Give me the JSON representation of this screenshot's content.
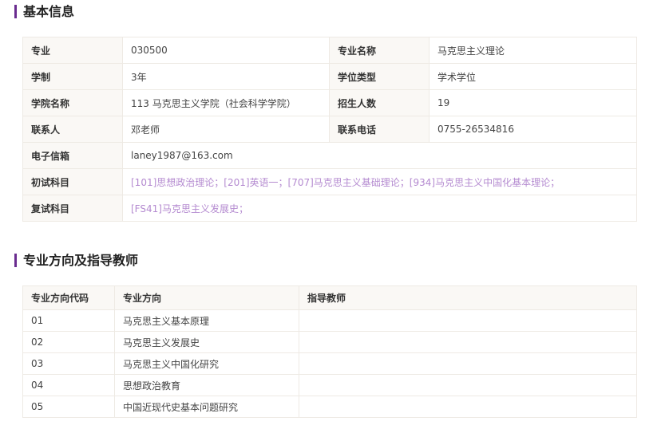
{
  "colors": {
    "accent": "#6a2c8f",
    "link": "#b48ad0",
    "label_bg": "#faf8f5",
    "border": "#eeeae4"
  },
  "basic": {
    "title": "基本信息",
    "major_label": "专业",
    "major_value": "030500",
    "major_name_label": "专业名称",
    "major_name_value": "马克思主义理论",
    "duration_label": "学制",
    "duration_value": "3年",
    "degree_label": "学位类型",
    "degree_value": "学术学位",
    "college_label": "学院名称",
    "college_value": "113 马克思主义学院（社会科学学院）",
    "enroll_label": "招生人数",
    "enroll_value": "19",
    "contact_label": "联系人",
    "contact_value": "邓老师",
    "phone_label": "联系电话",
    "phone_value": "0755-26534816",
    "email_label": "电子信箱",
    "email_value": "laney1987@163.com",
    "prelim_label": "初试科目",
    "prelim_value": "[101]思想政治理论；[201]英语一；[707]马克思主义基础理论；[934]马克思主义中国化基本理论；",
    "retest_label": "复试科目",
    "retest_value": "[FS41]马克思主义发展史；"
  },
  "directions": {
    "title": "专业方向及指导教师",
    "headers": [
      "专业方向代码",
      "专业方向",
      "指导教师"
    ],
    "rows": [
      {
        "code": "01",
        "name": "马克思主义基本原理",
        "advisor": ""
      },
      {
        "code": "02",
        "name": "马克思主义发展史",
        "advisor": ""
      },
      {
        "code": "03",
        "name": "马克思主义中国化研究",
        "advisor": ""
      },
      {
        "code": "04",
        "name": "思想政治教育",
        "advisor": ""
      },
      {
        "code": "05",
        "name": "中国近现代史基本问题研究",
        "advisor": ""
      }
    ]
  }
}
